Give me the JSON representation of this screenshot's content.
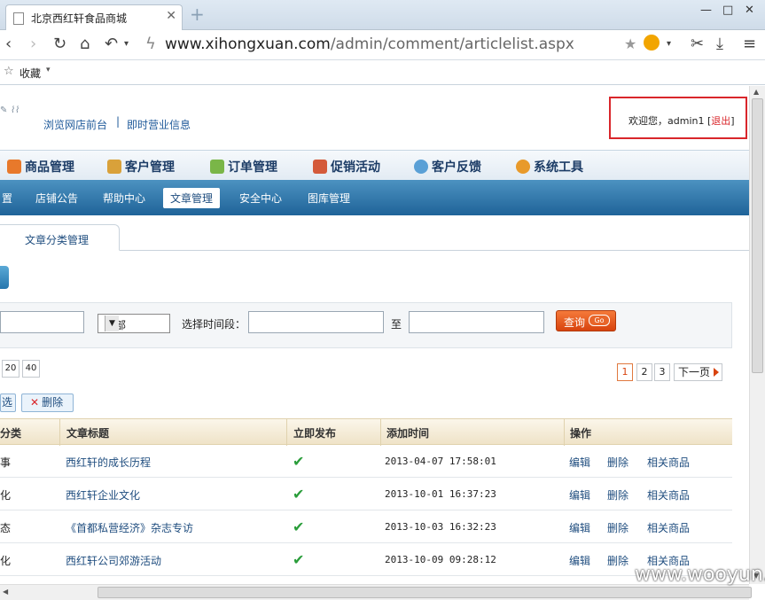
{
  "browser": {
    "tab_title": "北京西红轩食品商城",
    "url_domain": "www.xihongxuan.com",
    "url_path": "/admin/comment/articlelist.aspx",
    "bookmarks_label": "收藏"
  },
  "header": {
    "links": [
      "浏览网店前台",
      "即时营业信息"
    ],
    "welcome_prefix": "欢迎您，admin1 [",
    "logout": "退出",
    "welcome_suffix": "]"
  },
  "main_nav": [
    "商品管理",
    "客户管理",
    "订单管理",
    "促销活动",
    "客户反馈",
    "系统工具"
  ],
  "sub_nav": [
    "置",
    "店铺公告",
    "帮助中心",
    "文章管理",
    "安全中心",
    "图库管理"
  ],
  "sub_nav_active": "文章管理",
  "tabs": {
    "category": "文章分类管理"
  },
  "search": {
    "select_value": "全部",
    "time_label": "选择时间段：",
    "to_label": "至",
    "query_button": "查询",
    "go_label": "Go"
  },
  "page_sizes": [
    "20",
    "40"
  ],
  "pagination": {
    "pages": [
      "1",
      "2",
      "3"
    ],
    "current": "1",
    "next": "下一页"
  },
  "actions": {
    "select": "选",
    "delete": "删除"
  },
  "table": {
    "headers": [
      "分类",
      "文章标题",
      "立即发布",
      "添加时间",
      "操作"
    ],
    "rows": [
      {
        "category": "事",
        "title": "西红轩的成长历程",
        "published": "✔",
        "date": "2013-04-07 17:58:01"
      },
      {
        "category": "化",
        "title": "西红轩企业文化",
        "published": "✔",
        "date": "2013-10-01 16:37:23"
      },
      {
        "category": "态",
        "title": "《首都私营经济》杂志专访",
        "published": "✔",
        "date": "2013-10-03 16:32:23"
      },
      {
        "category": "化",
        "title": "西红轩公司郊游活动",
        "published": "✔",
        "date": "2013-10-09 09:28:12"
      }
    ],
    "ops": [
      "编辑",
      "删除",
      "相关商品"
    ]
  },
  "watermark": "www.wooyun.org",
  "colors": {
    "accent": "#d8430e",
    "nav_blue": "#1f6399",
    "link": "#1f4d7f",
    "alert_border": "#d9262b"
  }
}
